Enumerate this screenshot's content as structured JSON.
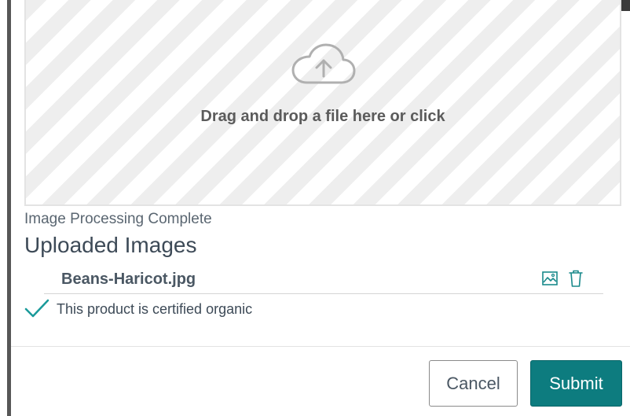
{
  "upload": {
    "dropzone_text": "Drag and drop a file here or click",
    "status": "Image Processing Complete",
    "section_title": "Uploaded Images",
    "files": [
      {
        "name": "Beans-Haricot.jpg"
      }
    ]
  },
  "organic": {
    "checked": true,
    "label": "This product is certified organic"
  },
  "actions": {
    "cancel_label": "Cancel",
    "submit_label": "Submit"
  },
  "icons": {
    "dropzone": "cloud-upload-icon",
    "preview": "image-icon",
    "delete": "trash-icon",
    "organic": "checkmark-icon"
  },
  "colors": {
    "accent": "#0d7c7f",
    "check": "#1a9a9a",
    "text": "#3d4a57"
  }
}
